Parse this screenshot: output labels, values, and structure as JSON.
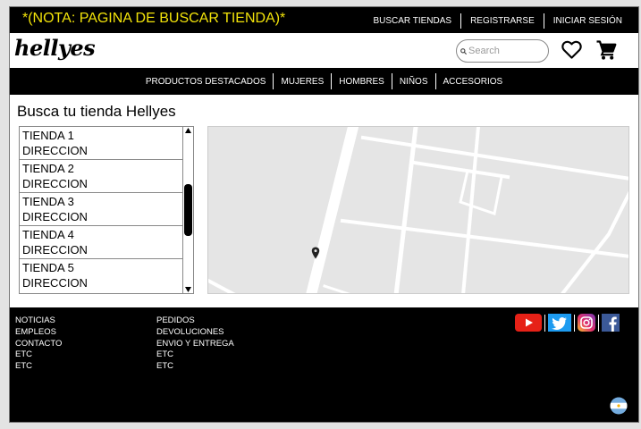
{
  "topbar": {
    "note": "*(NOTA: PAGINA DE BUSCAR TIENDA)*",
    "links": [
      "BUSCAR TIENDAS",
      "REGISTRARSE",
      "INICIAR SESIÓN"
    ]
  },
  "header": {
    "logo": "hellyes",
    "search_placeholder": "Search",
    "icons": [
      "heart-icon",
      "cart-icon"
    ]
  },
  "nav": [
    "PRODUCTOS DESTACADOS",
    "MUJERES",
    "HOMBRES",
    "NIÑOS",
    "ACCESORIOS"
  ],
  "main": {
    "title": "Busca tu tienda Hellyes",
    "stores": [
      {
        "name": "TIENDA 1",
        "address": "DIRECCION"
      },
      {
        "name": "TIENDA 2",
        "address": "DIRECCION"
      },
      {
        "name": "TIENDA 3",
        "address": "DIRECCION"
      },
      {
        "name": "TIENDA 4",
        "address": "DIRECCION"
      },
      {
        "name": "TIENDA 5",
        "address": "DIRECCION"
      }
    ],
    "map_icons": [
      "map-pin-icon"
    ]
  },
  "footer": {
    "col1": [
      "NOTICIAS",
      "EMPLEOS",
      "CONTACTO",
      "ETC",
      "ETC"
    ],
    "col2": [
      "PEDIDOS",
      "DEVOLUCIONES",
      "ENVIO Y ENTREGA",
      "ETC",
      "ETC"
    ],
    "social": [
      "youtube-icon",
      "twitter-icon",
      "instagram-icon",
      "facebook-icon"
    ],
    "flag": "argentina-flag-icon"
  },
  "colors": {
    "accent_yellow": "#f2e30a",
    "bar_black": "#000000",
    "map_bg": "#e5e5e5",
    "youtube_red": "#e62117",
    "twitter_blue": "#1d9bf0",
    "facebook_blue": "#3b5998",
    "flag_blue": "#74acdf"
  }
}
